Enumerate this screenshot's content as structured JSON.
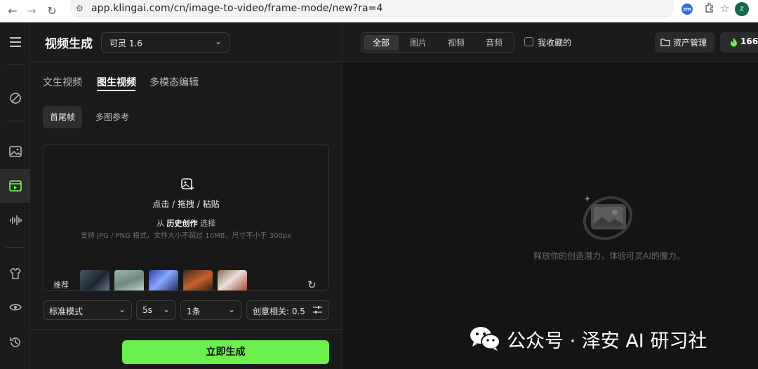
{
  "browser": {
    "url": "app.klingai.com/cn/image-to-video/frame-mode/new?ra=4",
    "profile_initial": "z",
    "ext_badge": "zm"
  },
  "header": {
    "title": "视频生成",
    "model": "可灵 1.6"
  },
  "tabs": [
    {
      "label": "文生视频"
    },
    {
      "label": "图生视频"
    },
    {
      "label": "多模态编辑"
    }
  ],
  "subtabs": [
    {
      "label": "首尾帧"
    },
    {
      "label": "多图参考"
    }
  ],
  "upload": {
    "main": "点击 / 拖拽 / 粘贴",
    "from": "从",
    "history": "历史创作",
    "select": "选择",
    "hint": "支持 JPG / PNG 格式，文件大小不超过 10MB，尺寸不小于 300px",
    "recommend_label": "推荐"
  },
  "controls": {
    "mode": "标准模式",
    "duration": "5s",
    "count": "1条",
    "creativity": "创意相关: 0.5"
  },
  "generate_label": "立即生成",
  "gallery": {
    "filters": [
      {
        "label": "全部"
      },
      {
        "label": "图片"
      },
      {
        "label": "视频"
      },
      {
        "label": "音频"
      }
    ],
    "favorites": "我收藏的",
    "assets": "资产管理",
    "credits": "166",
    "empty_text": "释放你的创造潜力，体验可灵AI的魔力。"
  },
  "watermark": "公众号 · 泽安 AI 研习社",
  "colors": {
    "accent": "#6cf04d",
    "background": "#141414",
    "panel": "#1b1b1b"
  },
  "icons": {
    "rail": [
      "menu-icon",
      "magic-wand-icon",
      "image-icon",
      "video-icon",
      "audio-wave-icon",
      "shirt-icon",
      "eye-icon",
      "history-icon"
    ]
  }
}
